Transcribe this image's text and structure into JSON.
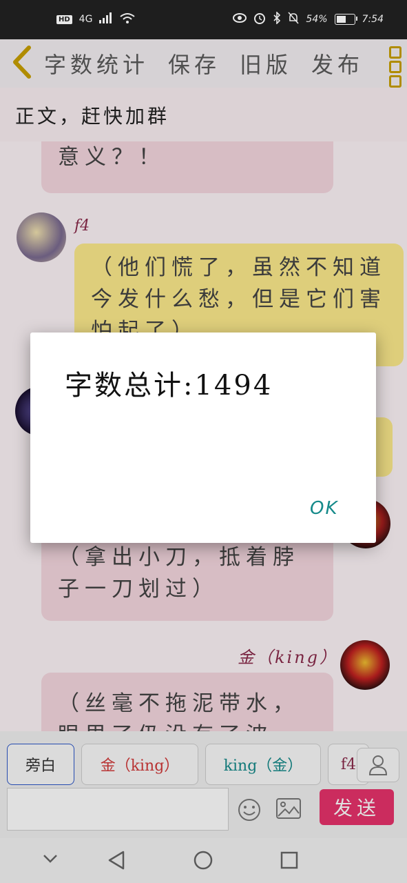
{
  "status_bar": {
    "network": "4G",
    "hd": "HD",
    "battery": "54%",
    "battery_level": 0.54,
    "time": "7:54"
  },
  "app_bar": {
    "back_icon": "chevron-left-icon",
    "word_count": "字数统计",
    "save": "保存",
    "old_version": "旧版",
    "publish": "发布",
    "menu_icon": "kebab-menu-icon",
    "accent": "#c9a000"
  },
  "notice": "正文，赶快加群",
  "chat": {
    "messages": [
      {
        "speaker": "",
        "text": "意义？！",
        "style": "pink"
      },
      {
        "speaker": "f4",
        "text": "（他们慌了，虽然不知道今发什么愁，但是它们害怕起了）",
        "style": "yellow"
      },
      {
        "speaker": "",
        "text": "（拿出小刀，抵着脖子一刀划过）",
        "style": "pink"
      },
      {
        "speaker": "金（king）",
        "text": "（丝毫不拖泥带水，眼里了仍没有了波澜，是",
        "style": "pink"
      }
    ]
  },
  "input": {
    "chips": [
      "旁白",
      "金（king）",
      "king（金）",
      "f4"
    ],
    "emoji_icon": "emoji-icon",
    "image_icon": "image-icon",
    "person_icon": "person-icon",
    "send": "发送",
    "send_color": "#e8336b"
  },
  "nav": {
    "collapse_icon": "chevron-down-icon",
    "back_icon": "triangle-back-icon",
    "home_icon": "circle-home-icon",
    "recents_icon": "square-recents-icon"
  },
  "dialog": {
    "message": "字数总计:1494",
    "ok": "OK",
    "ok_color": "#158a8a"
  }
}
